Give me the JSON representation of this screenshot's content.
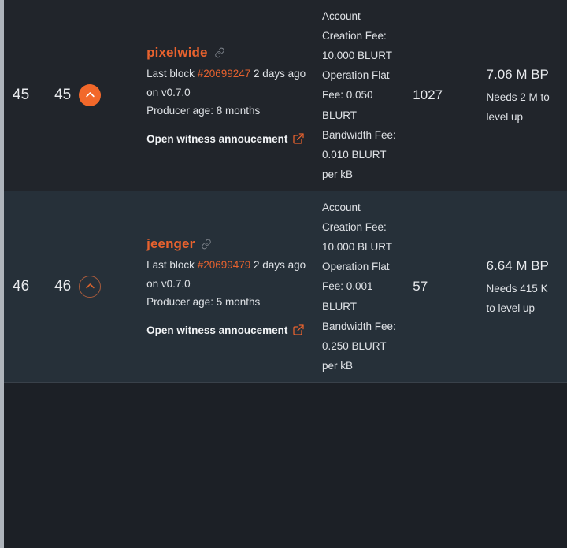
{
  "theme": {
    "accent": "#e8622e",
    "row_even_bg": "#21252b",
    "row_odd_bg": "#263039",
    "text": "#e8eaed",
    "muted": "#dfe2e6",
    "link_icon": "#7d838b"
  },
  "scrollbar": {
    "present": true
  },
  "icons": {
    "chain_link": "link-icon",
    "external_link": "external-link-icon",
    "up_chevron": "chevron-up-icon"
  },
  "table": {
    "rows": [
      {
        "rank": "45",
        "votes_rank": "45",
        "vote_state": "voted",
        "witness": "pixelwide",
        "last_block_label": "Last block",
        "last_block_number": "#20699247",
        "last_block_age": "2 days ago on v0.7.0",
        "producer_age": "Producer age: 8 months",
        "announcement_label": "Open witness annoucement",
        "fees": "Account Creation Fee: 10.000 BLURT Operation Flat Fee: 0.050 BLURT Bandwidth Fee: 0.010 BLURT per kB",
        "missed_blocks": "1027",
        "bp_amount": "7.06 M BP",
        "bp_note": "Needs 2 M to level up"
      },
      {
        "rank": "46",
        "votes_rank": "46",
        "vote_state": "not-voted",
        "witness": "jeenger",
        "last_block_label": "Last block",
        "last_block_number": "#20699479",
        "last_block_age": "2 days ago on v0.7.0",
        "producer_age": "Producer age: 5 months",
        "announcement_label": "Open witness annoucement",
        "fees": "Account Creation Fee: 10.000 BLURT Operation Flat Fee: 0.001 BLURT Bandwidth Fee: 0.250 BLURT per kB",
        "missed_blocks": "57",
        "bp_amount": "6.64 M BP",
        "bp_note": "Needs 415 K to level up"
      }
    ]
  }
}
